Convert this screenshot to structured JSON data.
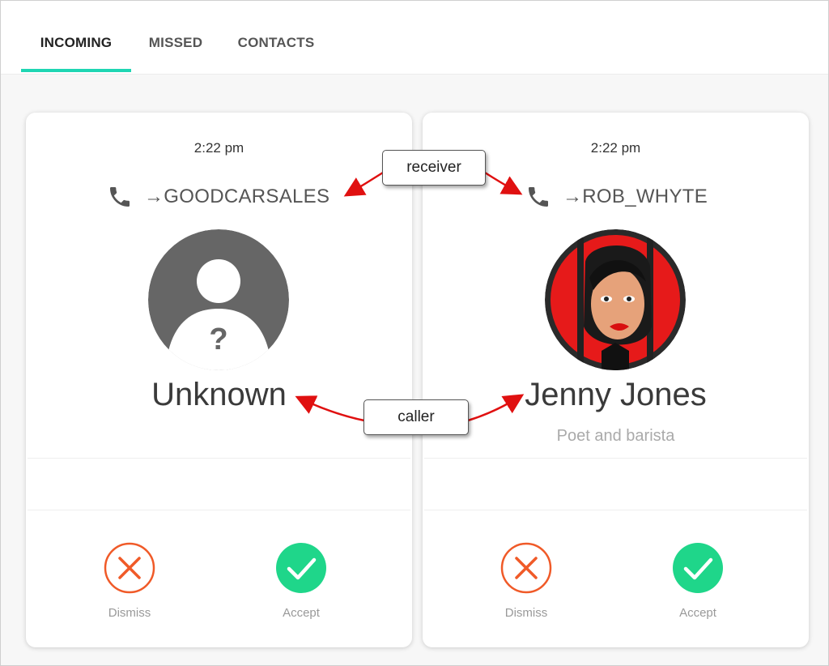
{
  "tabs": [
    {
      "label": "INCOMING",
      "active": true
    },
    {
      "label": "MISSED",
      "active": false
    },
    {
      "label": "CONTACTS",
      "active": false
    }
  ],
  "accent_color": "#1fd6b3",
  "calls": [
    {
      "time": "2:22 pm",
      "receiver": "→GOODCARSALES",
      "caller_name": "Unknown",
      "caller_subtitle": "",
      "avatar": "unknown-user-icon",
      "dismiss_label": "Dismiss",
      "accept_label": "Accept"
    },
    {
      "time": "2:22 pm",
      "receiver": "→ROB_WHYTE",
      "caller_name": "Jenny Jones",
      "caller_subtitle": "Poet and barista",
      "avatar": "jenny-jones-photo",
      "dismiss_label": "Dismiss",
      "accept_label": "Accept"
    }
  ],
  "annotations": {
    "receiver": "receiver",
    "caller": "caller"
  },
  "colors": {
    "dismiss": "#f05a28",
    "accept": "#1fd68a",
    "annotation_arrow": "#e01010"
  }
}
